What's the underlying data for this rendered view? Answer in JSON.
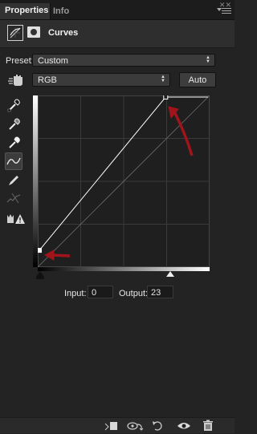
{
  "tabs": [
    {
      "label": "Properties",
      "active": true
    },
    {
      "label": "Info",
      "active": false
    }
  ],
  "header": {
    "title": "Curves"
  },
  "preset": {
    "label": "Preset:",
    "value": "Custom"
  },
  "channel": {
    "value": "RGB"
  },
  "auto_button": {
    "label": "Auto"
  },
  "tools": [
    {
      "icon": "eyedropper-black-point-icon"
    },
    {
      "icon": "eyedropper-gray-point-icon"
    },
    {
      "icon": "eyedropper-white-point-icon"
    },
    {
      "icon": "curve-edit-points-icon",
      "active": true
    },
    {
      "icon": "pencil-draw-icon"
    },
    {
      "icon": "smooth-curve-icon"
    },
    {
      "icon": "clipping-warning-icon"
    }
  ],
  "curve": {
    "input_max": 255,
    "output_max": 255,
    "points": [
      [
        0,
        23
      ],
      [
        191,
        255
      ],
      [
        255,
        255
      ]
    ]
  },
  "input": {
    "label": "Input:",
    "value": "0"
  },
  "output": {
    "label": "Output:",
    "value": "23"
  },
  "colors": {
    "panel_bg": "#232323",
    "annotation_arrow": "#a0141b",
    "curve_line": "#ffffff"
  },
  "bottom_icons": [
    "clip-to-layer-icon",
    "view-previous-state-icon",
    "reset-icon",
    "visibility-eye-icon",
    "trash-icon"
  ]
}
